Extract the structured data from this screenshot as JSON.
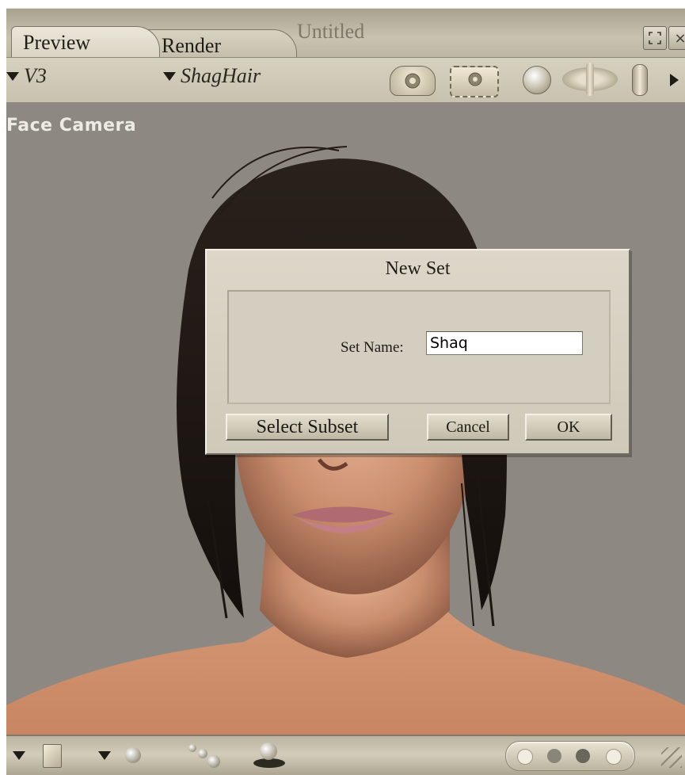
{
  "window": {
    "tabs": [
      {
        "label": "Preview",
        "active": true
      },
      {
        "label": "Render",
        "active": false
      }
    ],
    "document_title": "Untitled",
    "maximize_icon": "maximize-icon",
    "close_glyph": "×"
  },
  "toolbar": {
    "figure_menu": "V3",
    "element_menu": "ShagHair",
    "icons": [
      "camera-icon",
      "camera-frame-icon",
      "rotate-trackball-icon",
      "move-xy-icon",
      "scale-icon",
      "expand-arrow-icon"
    ]
  },
  "viewport": {
    "camera_label": "Face Camera",
    "background_color": "#8d8881"
  },
  "dialog": {
    "title": "New Set",
    "field_label": "Set Name:",
    "field_value": "Shaq",
    "buttons": {
      "select_subset": "Select Subset",
      "cancel": "Cancel",
      "ok": "OK"
    }
  },
  "bottom_bar": {
    "icons": [
      "display-style-menu-icon",
      "ground-square-icon",
      "light-menu-icon",
      "sphere-icon",
      "multiple-spheres-icon",
      "ground-shadow-icon",
      "render-dots-icon",
      "resize-grip-icon"
    ]
  }
}
